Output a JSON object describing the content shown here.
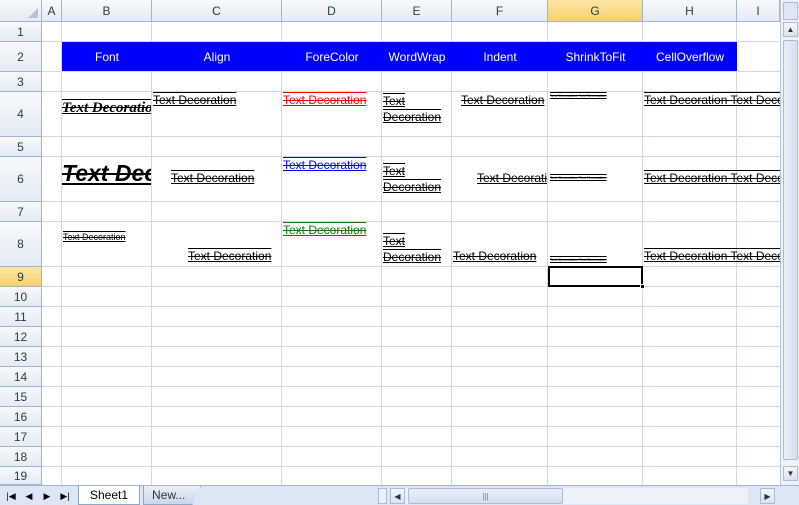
{
  "columns": [
    "A",
    "B",
    "C",
    "D",
    "E",
    "F",
    "G",
    "H",
    "I"
  ],
  "selected_column": "G",
  "rows": [
    "1",
    "2",
    "3",
    "4",
    "5",
    "6",
    "7",
    "8",
    "9",
    "10",
    "11",
    "12",
    "13",
    "14",
    "15",
    "16",
    "17",
    "18",
    "19"
  ],
  "selected_row": "9",
  "headers": {
    "font": "Font",
    "align": "Align",
    "forecolor": "ForeColor",
    "wordwrap": "WordWrap",
    "indent": "Indent",
    "shrinktofit": "ShrinkToFit",
    "celloverflow": "CellOverflow"
  },
  "cells": {
    "b4": "Text Decoration",
    "b6": "Text Decoration",
    "b8": "Text Decoration",
    "c4": "Text Decoration",
    "c6": "Text Decoration",
    "c8": "Text Decoration",
    "d4": "Text Decoration",
    "d6": "Text Decoration",
    "d8": "Text Decoration",
    "e4_line1": "Text",
    "e4_line2": "Decoration",
    "e6_line1": "Text",
    "e6_line2": "Decoration",
    "e8_line1": "Text",
    "e8_line2": "Decoration",
    "f4": "Text Decoration",
    "f6": "Text Decoration",
    "f8": "Text Decoration",
    "g4": "Text Decoration Text Decoration",
    "g6": "Text Decoration Text Decoration",
    "g8": "Text Decoration Text Decoration",
    "h4": "Text Decoration Text Decoration",
    "h6": "Text Decoration Text Decoration",
    "h8": "Text Decoration Text Decoration"
  },
  "colors": {
    "header_fill": "#0000ff",
    "header_text": "#ffffff",
    "forecolor_red": "#ff0000",
    "forecolor_blue": "#0000ff",
    "forecolor_green": "#008000",
    "selection": "#f9cf6c",
    "gridline": "#d0d7e5"
  },
  "tabs": {
    "active": "Sheet1",
    "new": "New..."
  },
  "icons": {
    "first_sheet": "first-sheet-icon",
    "prev_sheet": "prev-sheet-icon",
    "next_sheet": "next-sheet-icon",
    "last_sheet": "last-sheet-icon"
  }
}
